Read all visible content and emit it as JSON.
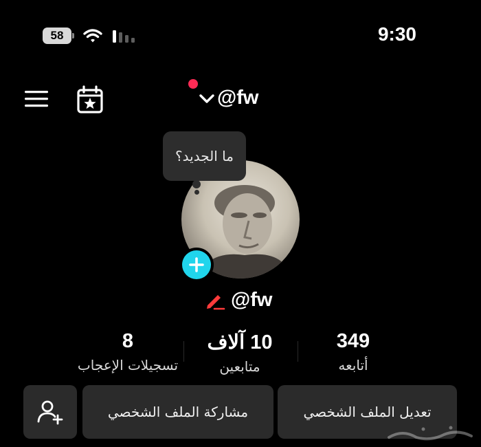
{
  "status_bar": {
    "battery": "58",
    "time": "9:30"
  },
  "header": {
    "username": "@fw",
    "has_notification": true
  },
  "tooltip": {
    "text": "ما الجديد؟"
  },
  "profile": {
    "handle": "@fw"
  },
  "stats": {
    "following": {
      "value": "349",
      "label": "أتابعه"
    },
    "followers": {
      "value": "10 آلاف",
      "label": "متابعين"
    },
    "likes": {
      "value": "8",
      "label": "تسجيلات الإعجاب"
    }
  },
  "buttons": {
    "edit_profile": "تعديل الملف الشخصي",
    "share_profile": "مشاركة الملف الشخصي"
  },
  "colors": {
    "background": "#000000",
    "accent_cyan": "#20d5ec",
    "notification_red": "#ff2b55",
    "button_bg": "#2b2b2b"
  },
  "icons": [
    "menu-icon",
    "calendar-star-icon",
    "chevron-down-icon",
    "plus-icon",
    "pencil-icon",
    "add-user-icon",
    "wifi-icon",
    "signal-icon",
    "battery-icon"
  ]
}
